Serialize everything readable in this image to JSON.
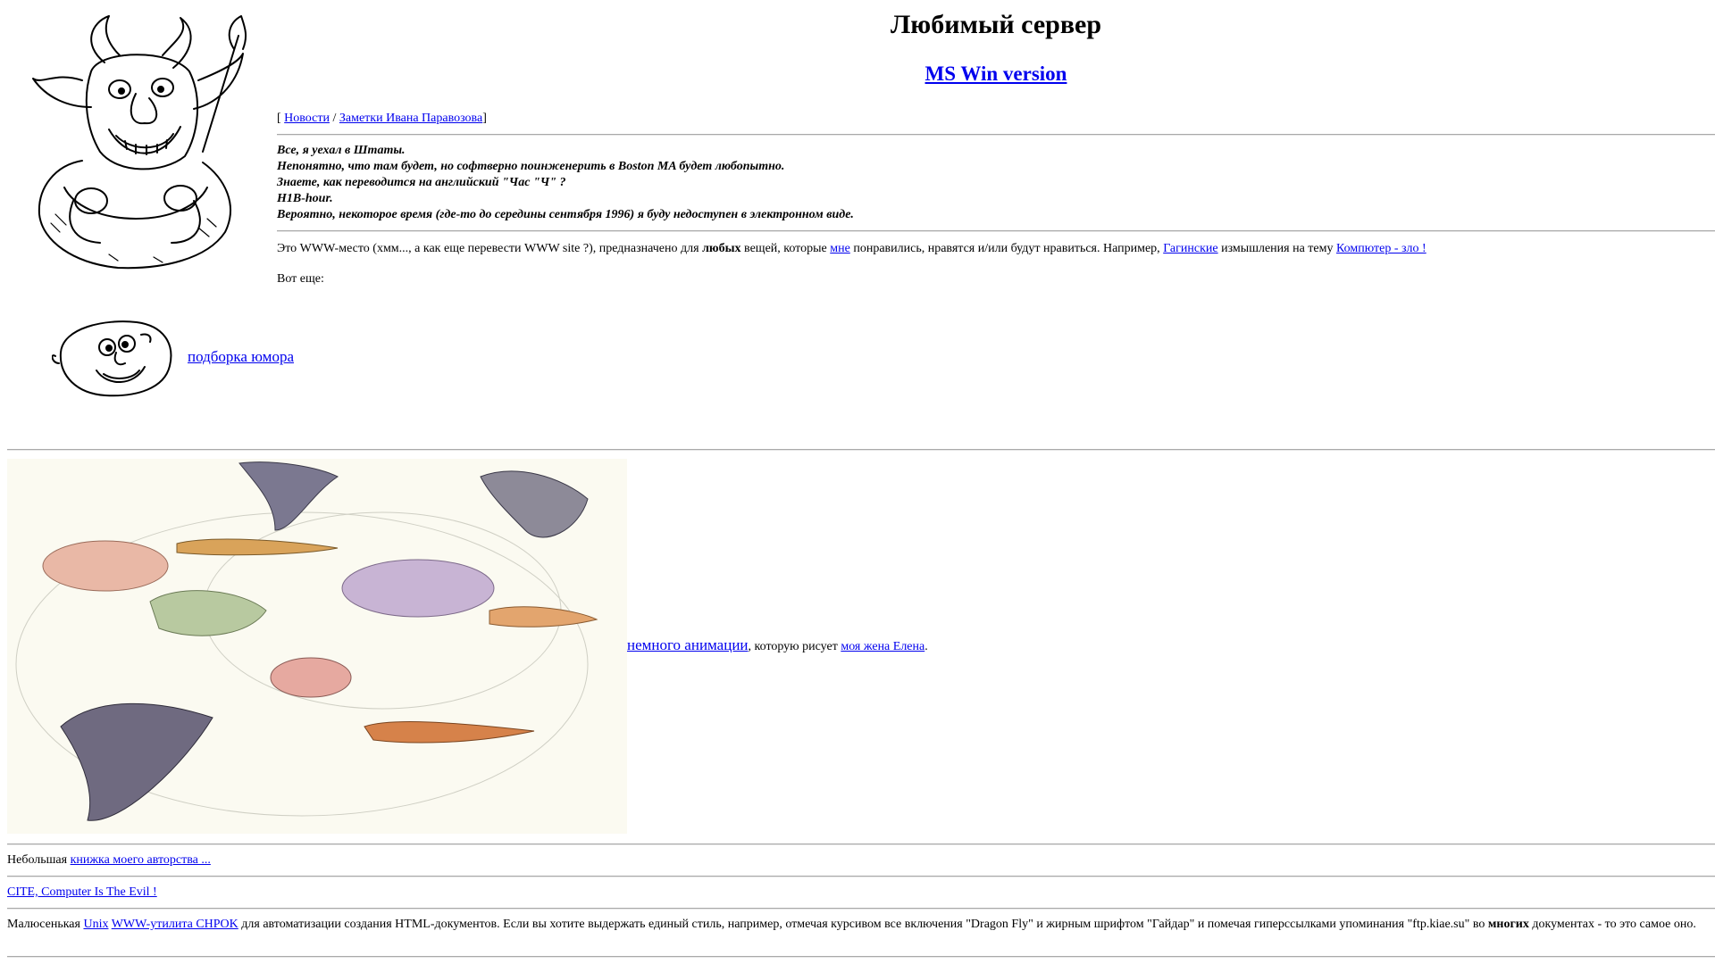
{
  "header": {
    "title": "Любимый сервер",
    "mswin_link": "MS Win version"
  },
  "nav": {
    "open_bracket": "[ ",
    "news": "Новости",
    "separator": " / ",
    "notes": "Заметки Ивана Паравозова",
    "close_bracket": "]"
  },
  "notice": {
    "lines": [
      "Все, я уехал в Штаты.",
      "Непонятно, что там будет, но софтверно поинженерить в Boston MA будет любопытно.",
      "Знаете, как переводится на английский \"Час \"Ч\" ?",
      "H1B-hour.",
      "Вероятно, некоторое время (где-то до середины сентября 1996) я буду недоступен в электронном виде."
    ]
  },
  "intro": {
    "part1": "Это WWW-место (хмм..., а как еще перевести WWW site ?), предназначено для ",
    "bold_word": "любых",
    "part2": " вещей, которые ",
    "link_me": "мне",
    "part3": " понравились, нравятся и/или будут нравиться. Например, ",
    "link_gagin": "Гагинские",
    "part4": " измышления на тему ",
    "link_computer": "Компютер - зло !"
  },
  "more": "Вот еще:",
  "humor": {
    "link": " подборка юмора"
  },
  "animation": {
    "link": " немного анимации",
    "text_mid": ", которую рисует ",
    "link_wife": "моя жена Елена",
    "text_end": "."
  },
  "book": {
    "prefix": "Небольшая ",
    "link": "книжка моего авторства ..."
  },
  "cite": {
    "link": "CITE, Computer Is The Evil !"
  },
  "utility": {
    "prefix": "Малюсенькая ",
    "link_unix": "Unix",
    "space": " ",
    "link_util": "WWW-утилита CHPOK",
    "text1": " для автоматизации создания HTML-документов. Если вы хотите выдержать единый стиль, например, отмечая курсивом все включения \"Dragon Fly\" и жирным шрифтом \"Гайдар\" и помечая гиперссылками упоминания \"ftp.kiae.su\" во ",
    "bold": "многих",
    "text2": " документах - то это самое оно."
  }
}
